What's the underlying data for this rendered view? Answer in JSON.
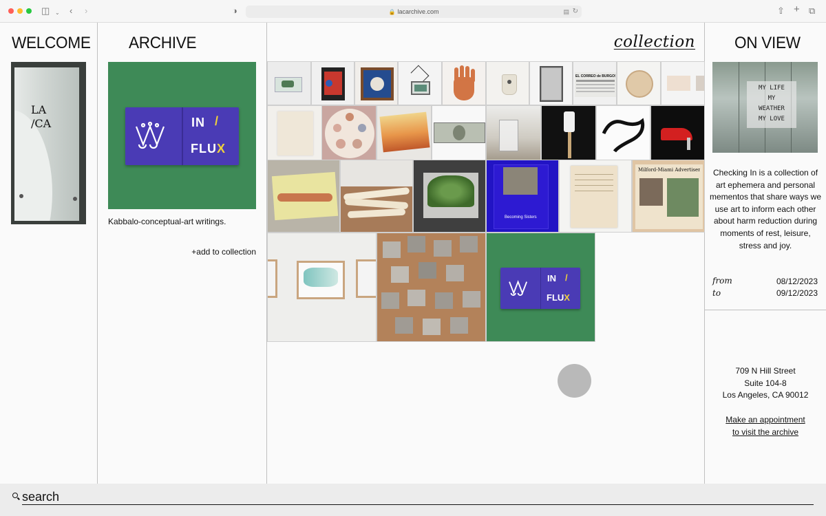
{
  "browser": {
    "url": "lacarchive.com",
    "colors": {
      "close": "#ff5f57",
      "minimize": "#febc2e",
      "maximize": "#28c840"
    }
  },
  "welcome": {
    "title": "WELCOME",
    "door_sticker": "LA\n/CA"
  },
  "archive": {
    "title": "ARCHIVE",
    "feature": {
      "book_word_1": "IN",
      "book_word_2": "FLU",
      "book_word_3": "X",
      "caption": "Kabbalo-conceptual-art writings."
    },
    "add_label": "+add to collection"
  },
  "collection": {
    "title": "collection",
    "items": [
      {
        "name": "resin-block"
      },
      {
        "name": "poster-red-frame"
      },
      {
        "name": "framed-blue-print"
      },
      {
        "name": "hanging-frame"
      },
      {
        "name": "ceramic-hand"
      },
      {
        "name": "ceramic-cup"
      },
      {
        "name": "gray-board"
      },
      {
        "name": "newspaper-el-correo"
      },
      {
        "name": "round-plate"
      },
      {
        "name": "pink-card"
      },
      {
        "name": "blank-paper"
      },
      {
        "name": "circle-chart"
      },
      {
        "name": "sunset-painting"
      },
      {
        "name": "dollar-bill"
      },
      {
        "name": "plastic-bag"
      },
      {
        "name": "white-spatula"
      },
      {
        "name": "black-rope"
      },
      {
        "name": "red-shoe"
      },
      {
        "name": "reclining-painting"
      },
      {
        "name": "bone-tusks"
      },
      {
        "name": "green-plant"
      },
      {
        "name": "becoming-sisters-book"
      },
      {
        "name": "handwritten-letter"
      },
      {
        "name": "milford-newspaper"
      },
      {
        "name": "framed-drawings"
      },
      {
        "name": "wood-blocks"
      },
      {
        "name": "in-flux-book"
      }
    ],
    "becoming_sisters_text": "Becoming Sisters",
    "newspaper_text": "EL CORREO de BURGOS",
    "milford_text": "Milford-Miami Advertiser"
  },
  "onview": {
    "title": "ON VIEW",
    "poster_text": "MY LIFE\nMY\nWEATHER\nMY LOVE",
    "description": "Checking In is a collection of art ephemera and personal mementos that share ways we use art to inform each other about harm reduction during moments of rest, leisure, stress and joy.",
    "from_label": "from",
    "from_date": "08/12/2023",
    "to_label": "to",
    "to_date": "09/12/2023",
    "address_line1": "709 N Hill Street",
    "address_line2": "Suite 104-8",
    "address_line3": "Los Angeles, CA 90012",
    "appointment_line1": "Make an appointment",
    "appointment_line2": "to visit the archive"
  },
  "search": {
    "placeholder": "search"
  },
  "colors": {
    "feature_green": "#3e8a57",
    "book_purple": "#4a3bb5",
    "accent_yellow": "#f0d23b"
  }
}
